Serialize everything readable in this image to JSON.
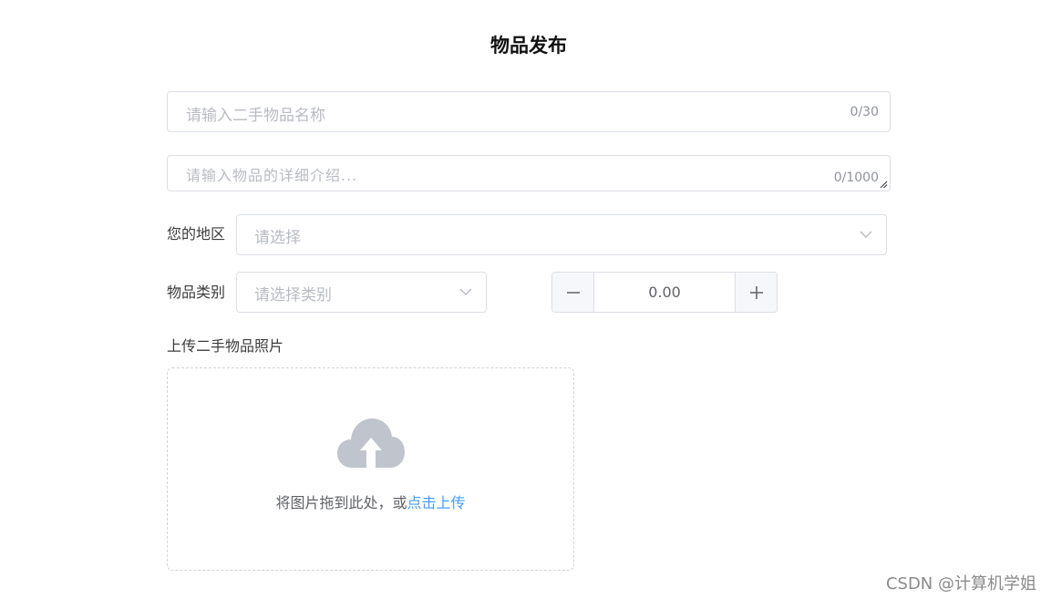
{
  "page": {
    "title": "物品发布"
  },
  "name_field": {
    "placeholder": "请输入二手物品名称",
    "counter": "0/30"
  },
  "desc_field": {
    "placeholder": "请输入物品的详细介绍...",
    "counter": "0/1000"
  },
  "region": {
    "label": "您的地区",
    "placeholder": "请选择"
  },
  "category": {
    "label": "物品类别",
    "placeholder": "请选择类别"
  },
  "price_stepper": {
    "value": "0.00",
    "minus_icon": "minus-icon",
    "plus_icon": "plus-icon"
  },
  "upload": {
    "label": "上传二手物品照片",
    "hint": "将图片拖到此处，或",
    "link": "点击上传",
    "icon": "cloud-upload-icon"
  },
  "watermark": "CSDN @计算机学姐",
  "colors": {
    "accent": "#409eff",
    "border": "#dcdfe6",
    "placeholder": "#b8bbc2",
    "icon_gray": "#c0c4cc"
  }
}
